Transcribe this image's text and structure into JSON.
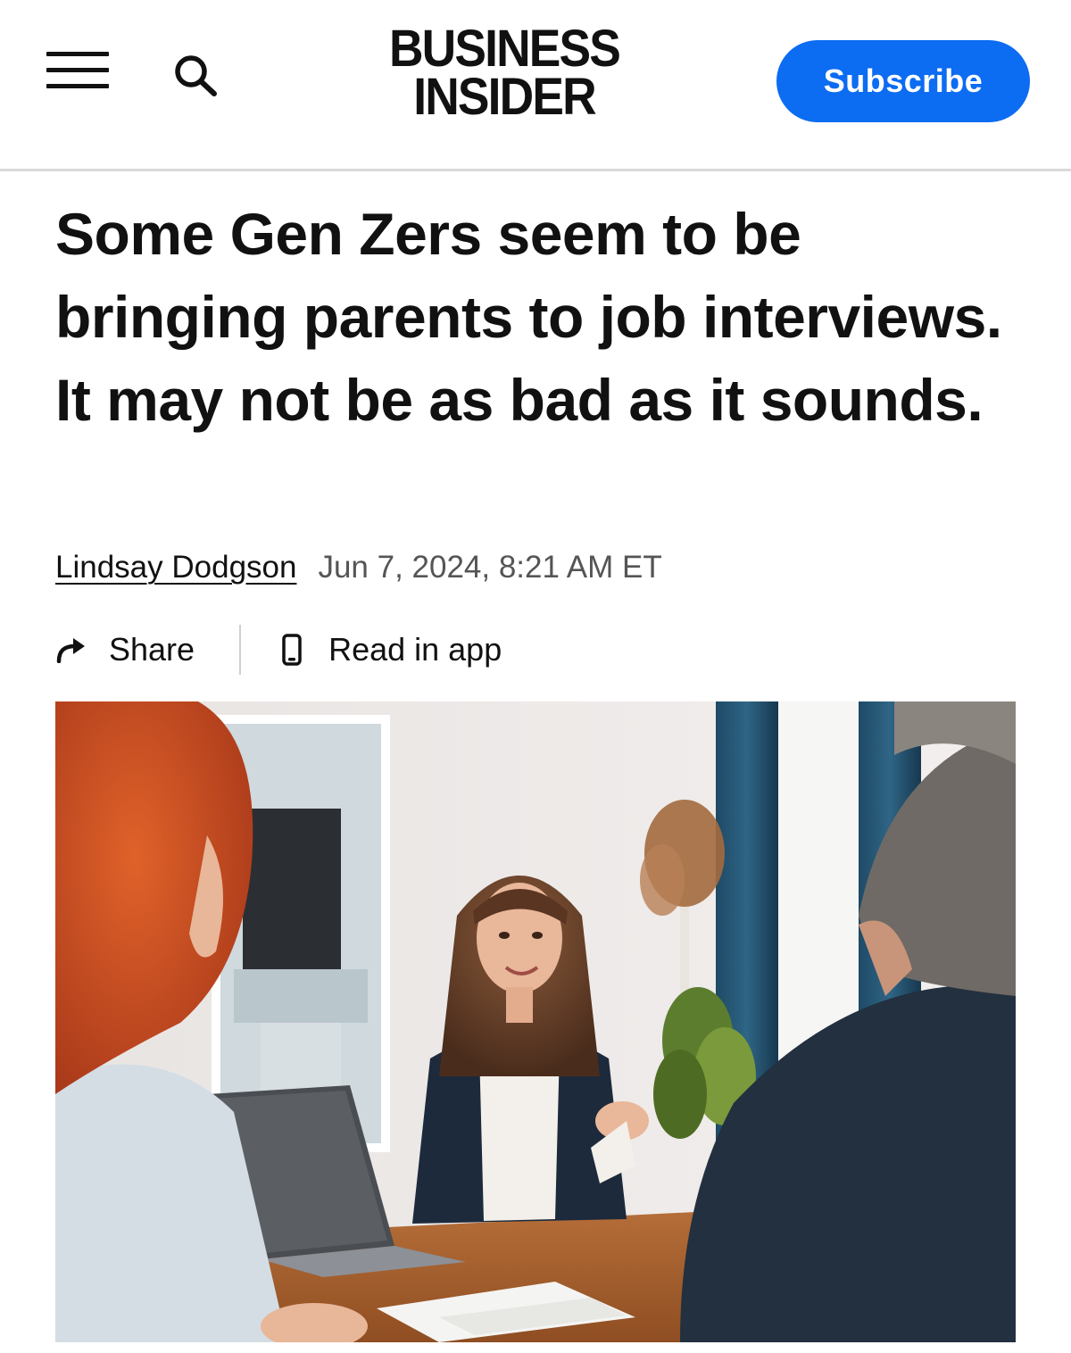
{
  "header": {
    "menu_icon": "hamburger-menu-icon",
    "search_icon": "search-icon",
    "logo_line1": "BUSINESS",
    "logo_line2": "INSIDER",
    "subscribe_label": "Subscribe",
    "accent_color": "#0c6cf2"
  },
  "article": {
    "headline": "Some Gen Zers seem to be bringing parents to job interviews. It may not be as bad as it sounds.",
    "author": "Lindsay Dodgson",
    "date": "Jun 7, 2024, 8:21 AM ET",
    "actions": {
      "share_label": "Share",
      "share_icon": "share-arrow-icon",
      "read_in_app_label": "Read in app",
      "read_in_app_icon": "phone-icon"
    }
  }
}
